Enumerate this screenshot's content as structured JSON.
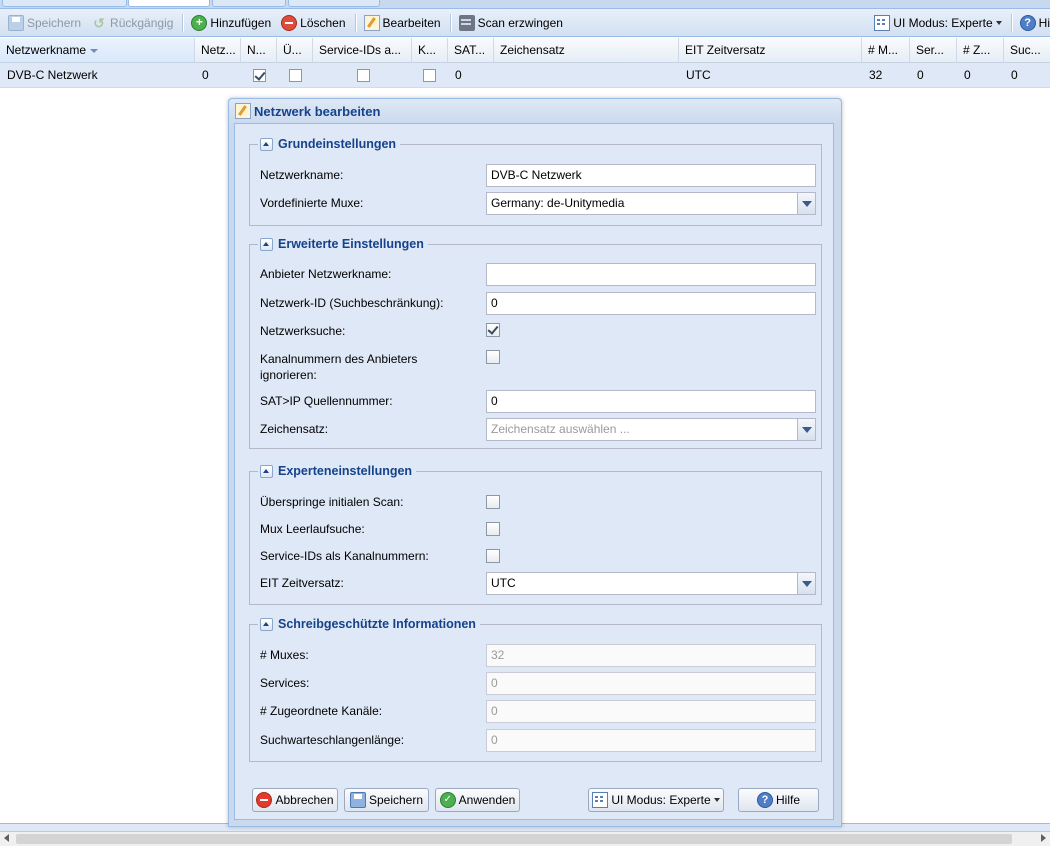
{
  "toolbar": {
    "save": "Speichern",
    "undo": "Rückgängig",
    "add": "Hinzufügen",
    "delete": "Löschen",
    "edit": "Bearbeiten",
    "force_scan": "Scan erzwingen",
    "ui_mode": "UI Modus: Experte",
    "help": "Hi"
  },
  "grid": {
    "columns": [
      "Netzwerkname",
      "Netz...",
      "N...",
      "Ü...",
      "Service-IDs a...",
      "K...",
      "SAT...",
      "Zeichensatz",
      "EIT Zeitversatz",
      "# M...",
      "Ser...",
      "# Z...",
      "Suc..."
    ],
    "row": {
      "name": "DVB-C Netzwerk",
      "netz": "0",
      "sat": "0",
      "eit": "UTC",
      "muxes": "32",
      "services": "0",
      "zugeordnet": "0",
      "such": "0"
    }
  },
  "dialog": {
    "title": "Netzwerk bearbeiten",
    "sections": {
      "basic": {
        "title": "Grundeinstellungen",
        "network_name_label": "Netzwerkname:",
        "network_name_value": "DVB-C Netzwerk",
        "predefined_label": "Vordefinierte Muxe:",
        "predefined_value": "Germany: de-Unitymedia"
      },
      "advanced": {
        "title": "Erweiterte Einstellungen",
        "provider_label": "Anbieter Netzwerkname:",
        "provider_value": "",
        "netid_label": "Netzwerk-ID (Suchbeschränkung):",
        "netid_value": "0",
        "netsearch_label": "Netzwerksuche:",
        "ignore_label": "Kanalnummern des Anbieters ignorieren:",
        "satip_label": "SAT>IP Quellennummer:",
        "satip_value": "0",
        "charset_label": "Zeichensatz:",
        "charset_placeholder": "Zeichensatz auswählen ..."
      },
      "expert": {
        "title": "Experteneinstellungen",
        "skip_label": "Überspringe initialen Scan:",
        "idle_label": "Mux Leerlaufsuche:",
        "sid_label": "Service-IDs als Kanalnummern:",
        "eit_label": "EIT Zeitversatz:",
        "eit_value": "UTC"
      },
      "readonly": {
        "title": "Schreibgeschützte Informationen",
        "muxes_label": "# Muxes:",
        "muxes_value": "32",
        "services_label": "Services:",
        "services_value": "0",
        "channels_label": "# Zugeordnete Kanäle:",
        "channels_value": "0",
        "queue_label": "Suchwarteschlangenlänge:",
        "queue_value": "0"
      }
    },
    "buttons": {
      "cancel": "Abbrechen",
      "save": "Speichern",
      "apply": "Anwenden",
      "ui_mode": "UI Modus: Experte",
      "help": "Hilfe"
    }
  }
}
